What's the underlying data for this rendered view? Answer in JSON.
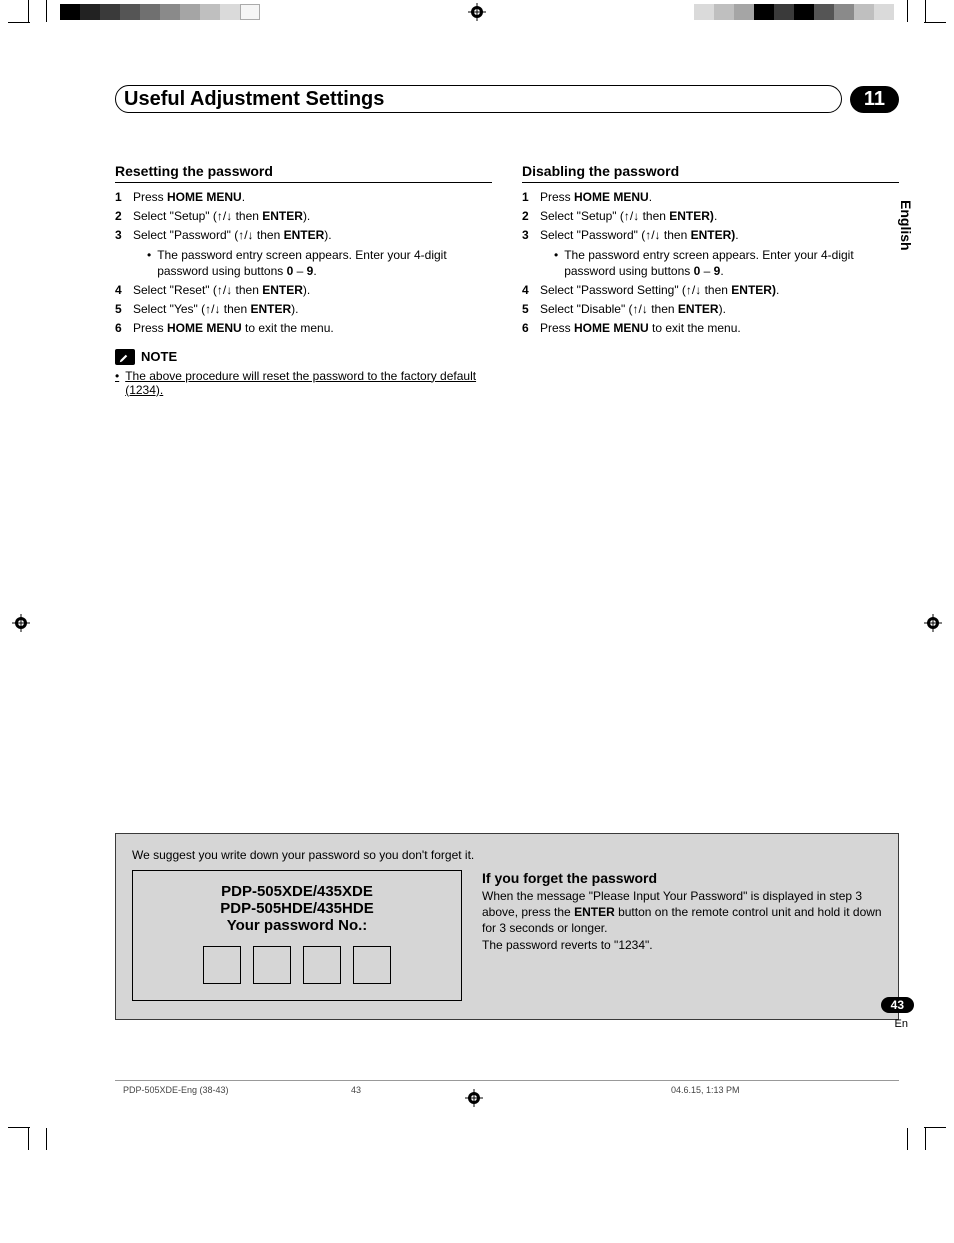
{
  "header": {
    "title": "Useful Adjustment Settings",
    "chapter": "11"
  },
  "lang_tab": "English",
  "left": {
    "heading": "Resetting the password",
    "steps": [
      {
        "n": "1",
        "html": "Press <b>HOME MENU</b>."
      },
      {
        "n": "2",
        "html": "Select \"Setup\" (↑/↓ then <b>ENTER</b>)."
      },
      {
        "n": "3",
        "html": "Select \"Password\" (↑/↓ then <b>ENTER</b>).",
        "sub": "The password entry screen appears. Enter your 4-digit password using buttons <b>0</b> – <b>9</b>."
      },
      {
        "n": "4",
        "html": "Select \"Reset\" (↑/↓ then <b>ENTER</b>)."
      },
      {
        "n": "5",
        "html": "Select \"Yes\" (↑/↓ then <b>ENTER</b>)."
      },
      {
        "n": "6",
        "html": "Press <b>HOME MENU</b> to exit the menu."
      }
    ],
    "note_label": "NOTE",
    "note_text": "The above procedure will reset the password to the factory default (1234)."
  },
  "right": {
    "heading": "Disabling the password",
    "steps": [
      {
        "n": "1",
        "html": "Press <b>HOME MENU</b>."
      },
      {
        "n": "2",
        "html": "Select \"Setup\" (↑/↓ then <b>ENTER)</b>."
      },
      {
        "n": "3",
        "html": "Select \"Password\" (↑/↓ then <b>ENTER)</b>.",
        "sub": "The password entry screen appears. Enter your 4-digit password using buttons <b>0</b> – <b>9</b>."
      },
      {
        "n": "4",
        "html": "Select \"Password Setting\" (↑/↓ then <b>ENTER)</b>."
      },
      {
        "n": "5",
        "html": "Select \"Disable\" (↑/↓ then <b>ENTER</b>)."
      },
      {
        "n": "6",
        "html": "Press <b>HOME MENU</b> to exit the menu."
      }
    ]
  },
  "bottom": {
    "suggest": "We suggest you write down your password so you don't forget it.",
    "card": {
      "line1": "PDP-505XDE/435XDE",
      "line2": "PDP-505HDE/435HDE",
      "line3": "Your password No.:"
    },
    "forgot": {
      "heading": "If you forget the password",
      "p1_html": "When the message \"Please Input Your Password\" is displayed in step 3 above, press the <b>ENTER</b> button on the remote control unit and hold it down for 3 seconds or longer.",
      "p2": "The password reverts to \"1234\"."
    }
  },
  "page_badge": "43",
  "page_sub": "En",
  "footer": {
    "left": "PDP-505XDE-Eng (38-43)",
    "mid": "43",
    "right": "04.6.15, 1:13 PM"
  }
}
